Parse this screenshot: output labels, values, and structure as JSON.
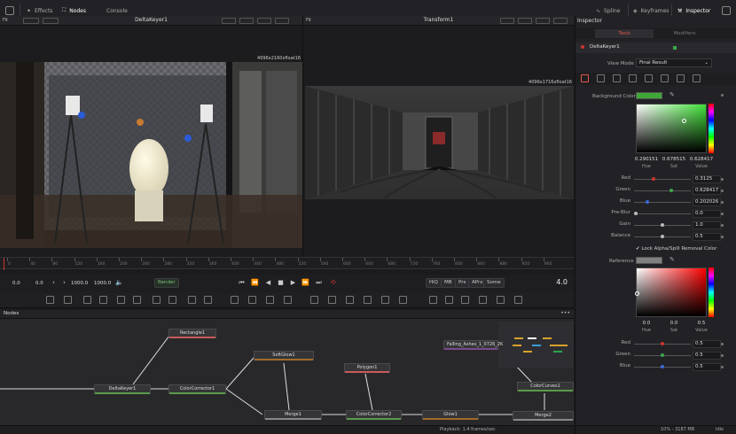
{
  "topbar": {
    "effects": "Effects",
    "nodes": "Nodes",
    "console": "Console",
    "spline": "Spline",
    "keyframes": "Keyframes",
    "inspector": "Inspector"
  },
  "viewer_left": {
    "title": "DeltaKeyer1",
    "fit": "Fit",
    "resolution": "4096x2160xfloat16"
  },
  "viewer_right": {
    "title": "Transform1",
    "fit": "Fit",
    "resolution": "4096x1716xfloat16"
  },
  "ruler": {
    "ticks": [
      "0",
      "40",
      "80",
      "120",
      "160",
      "200",
      "240",
      "280",
      "320",
      "360",
      "400",
      "440",
      "480",
      "520",
      "560",
      "600",
      "640",
      "680",
      "720",
      "760",
      "800",
      "840",
      "880",
      "920",
      "960"
    ]
  },
  "transport": {
    "start": "0.0",
    "current": "0.0",
    "end1": "1000.0",
    "end2": "1000.0",
    "render": "Render",
    "hiq": "HiQ",
    "mb": "MB",
    "prx": "Prx",
    "aprx": "APrx",
    "some": "Some",
    "frame": "4.0"
  },
  "nodes_panel": {
    "title": "Nodes",
    "nodes": {
      "rectangle": "Rectangle1",
      "softglow": "SoftGlow1",
      "polygon": "Polygon1",
      "falling": "Falling_Ashes_1_0726_2K",
      "deltakeyer": "DeltaKeyer1",
      "colorcorrector1": "ColorCorrector1",
      "colorcurves": "ColorCurves1",
      "merge1": "Merge1",
      "colorcorrector2": "ColorCorrector2",
      "glow": "Glow1",
      "merge2": "Merge2"
    }
  },
  "status": {
    "playback": "Playback: 1.4 frames/sec",
    "memory": "10% - 3187 MB",
    "idle": "Idle"
  },
  "inspector": {
    "title": "Inspector",
    "tab_tools": "Tools",
    "tab_modifiers": "Modifiers",
    "node_name": "DeltaKeyer1",
    "view_mode_label": "View Mode",
    "view_mode_value": "Final Result",
    "background_color_label": "Background Color",
    "bg_swatch": "#3fa637",
    "hsv1": {
      "h": "0.290151",
      "s": "0.678515",
      "v": "0.628417",
      "hue": "Hue",
      "sat": "Sat",
      "value": "Value"
    },
    "red_label": "Red",
    "red_value": "0.3125",
    "green_label": "Green",
    "green_value": "0.628417",
    "blue_label": "Blue",
    "blue_value": "0.202026",
    "preblur_label": "Pre-Blur",
    "preblur_value": "0.0",
    "gain_label": "Gain",
    "gain_value": "1.0",
    "balance_label": "Balance",
    "balance_value": "0.5",
    "lock_label": "Lock Alpha/Spill Removal Color",
    "reference_label": "Reference",
    "ref_swatch": "#808080",
    "hsv2": {
      "h": "0.0",
      "s": "0.0",
      "v": "0.5",
      "hue": "Hue",
      "sat": "Sat",
      "value": "Value"
    },
    "red2_value": "0.5",
    "green2_value": "0.5",
    "blue2_value": "0.5"
  }
}
